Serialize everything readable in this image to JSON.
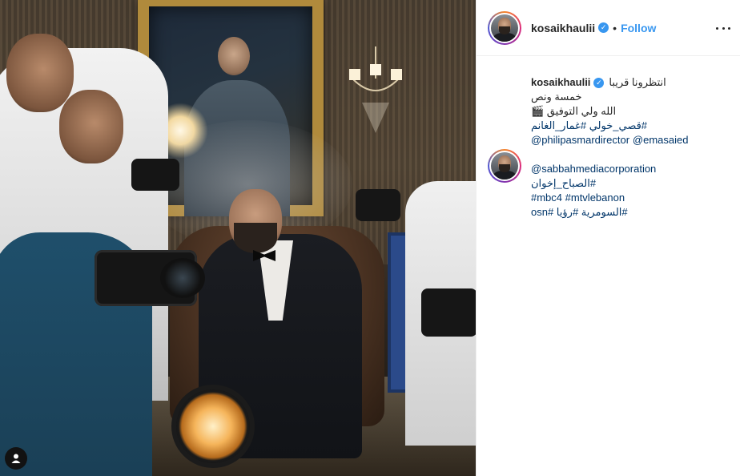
{
  "post": {
    "username": "kosaikhaulii",
    "verified_mark": "✓",
    "separator": "•",
    "follow_label": "Follow"
  },
  "caption": {
    "username": "kosaikhaulii",
    "line1": "انتظرونا قريبا",
    "line2": "خمسة ونص",
    "line3": "الله ولي التوفيق 🎬",
    "line4": "#قصي_خولي #غمار_الغانم",
    "line5": "@philipasmardirector",
    "line6": "@emasaied",
    "line8": "@sabbahmediacorporation",
    "line9": "#الصباح_إخوان",
    "line10": "#mbc4 #mtvlebanon",
    "line11": "#السومرية #رؤيا #osn"
  },
  "icons": {
    "verified": "verified-badge-icon",
    "more": "more-options-icon",
    "tag": "user-tag-icon",
    "avatar": "profile-avatar"
  },
  "colors": {
    "accent": "#3897f0",
    "text": "#262626",
    "link": "#003569",
    "border": "#efefef"
  }
}
